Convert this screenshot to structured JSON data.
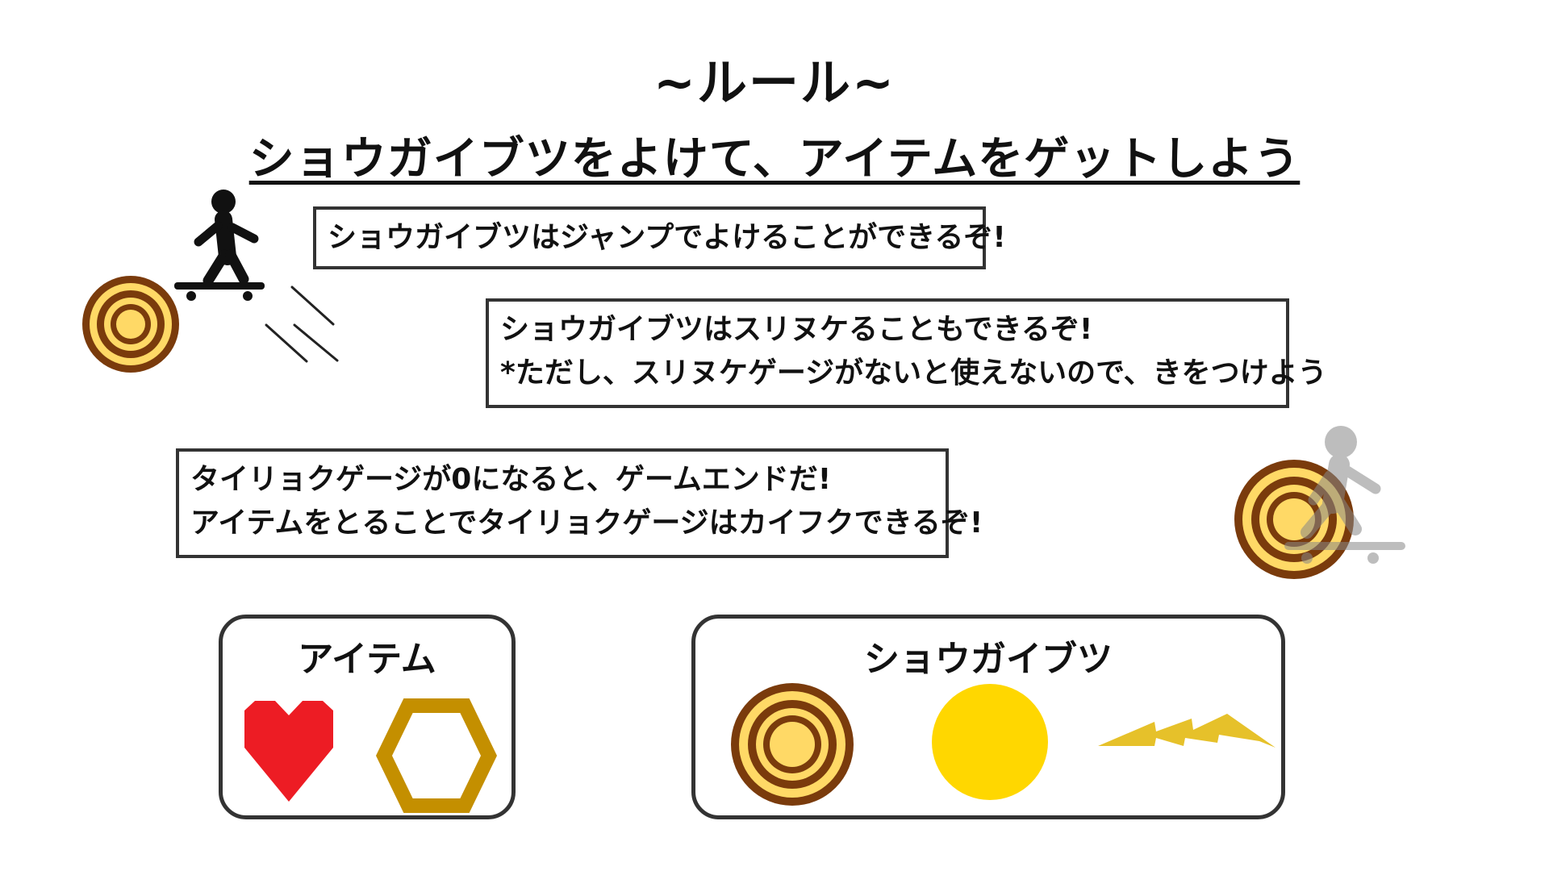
{
  "title": "~ルール~",
  "subtitle": "ショウガイブツをよけて、アイテムをゲットしよう",
  "rules": {
    "jump": "ショウガイブツはジャンプでよけることができるぞ!",
    "pass_through_1": "ショウガイブツはスリヌケることもできるぞ!",
    "pass_through_2": "*ただし、スリヌケゲージがないと使えないので、きをつけよう",
    "stamina_1": "タイリョクゲージが0になると、ゲームエンドだ!",
    "stamina_2": "アイテムをとることでタイリョクゲージはカイフクできるぞ!"
  },
  "items_panel": {
    "title": "アイテム",
    "icons": [
      "heart-icon",
      "hexagon-icon"
    ]
  },
  "obstacles_panel": {
    "title": "ショウガイブツ",
    "icons": [
      "log-icon",
      "sun-orb-icon",
      "lightning-icon"
    ]
  },
  "colors": {
    "heart": "#ed1c24",
    "hexagon": "#c48f00",
    "log_dark": "#7a3b0c",
    "log_light": "#ffd966",
    "orb": "#ffd700",
    "lightning": "#e6c12a",
    "border": "#333333"
  }
}
